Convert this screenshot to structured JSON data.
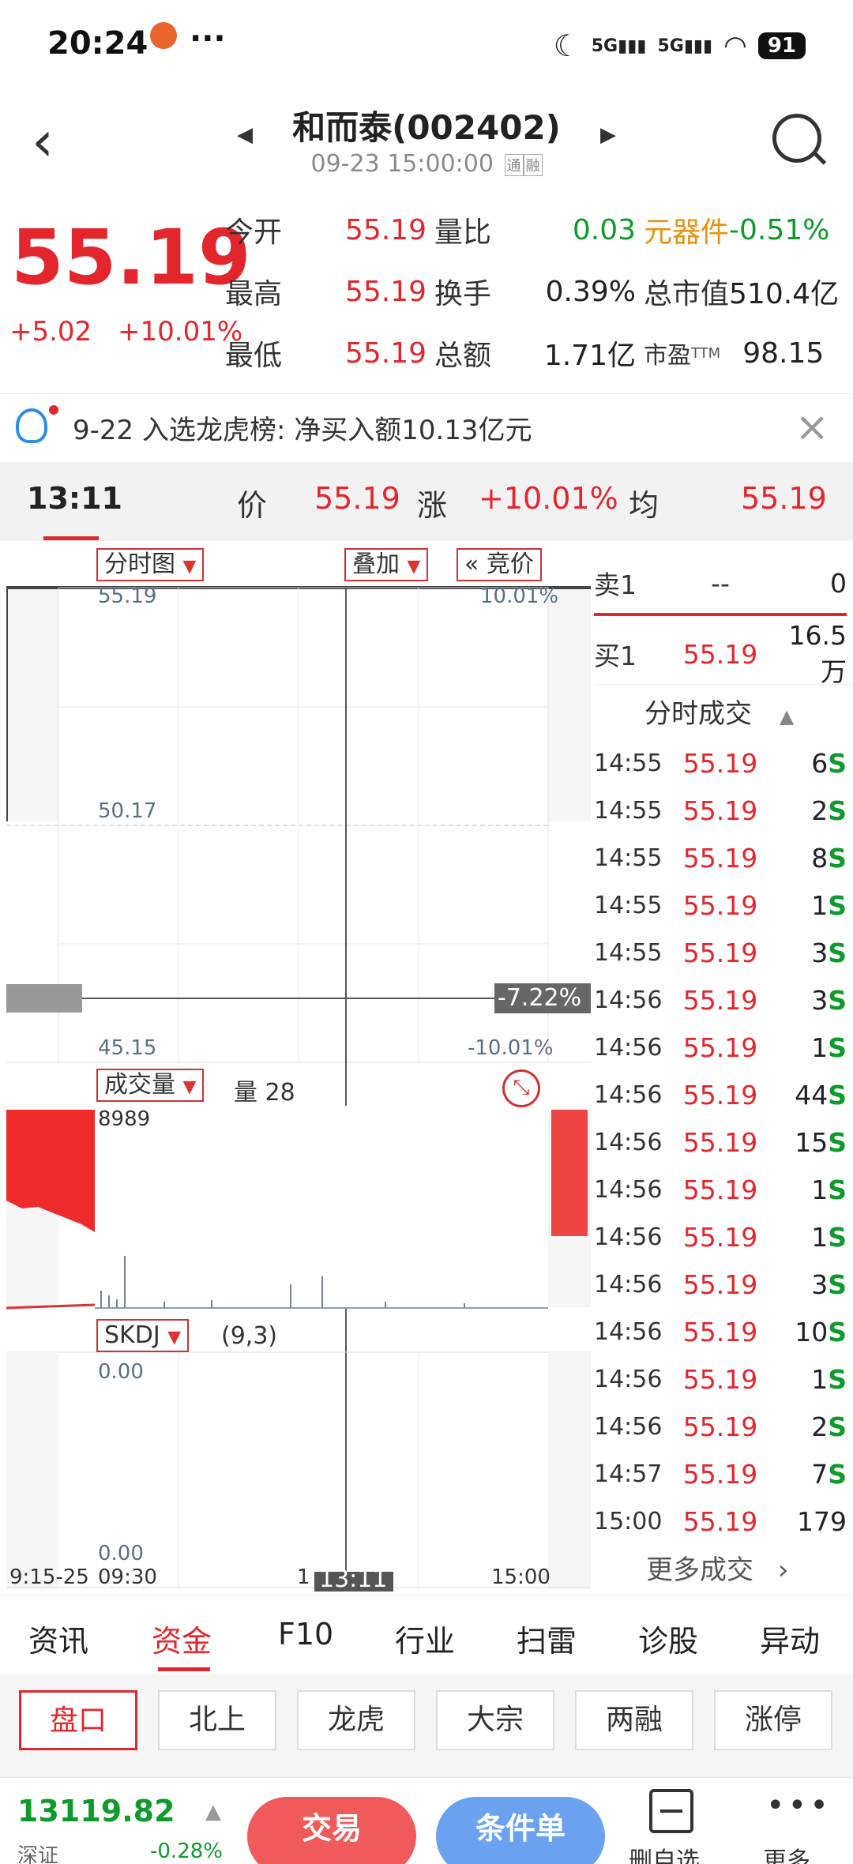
{
  "status_bar": {
    "time": "20:24",
    "dots": "···",
    "signal1": "5G",
    "signal2": "5G",
    "battery": "91"
  },
  "header": {
    "title": "和而泰(002402)",
    "subtitle": "09-23 15:00:00",
    "badge1": "通",
    "badge2": "融"
  },
  "quote": {
    "price": "55.19",
    "change": "+5.02",
    "change_pct": "+10.01%",
    "rows": [
      {
        "l1": "今开",
        "v1": "55.19",
        "l2": "量比",
        "v2": "0.03",
        "l3": "元器件",
        "v3": "-0.51%"
      },
      {
        "l1": "最高",
        "v1": "55.19",
        "l2": "换手",
        "v2": "0.39%",
        "l3": "总市值",
        "v3": "510.4亿"
      },
      {
        "l1": "最低",
        "v1": "55.19",
        "l2": "总额",
        "v2": "1.71亿",
        "l3": "市盈",
        "v3": "98.15",
        "l3_sup": "TTM"
      }
    ]
  },
  "notice": {
    "text": "9-22 入选龙虎榜: 净买入额10.13亿元"
  },
  "info_bar": {
    "time": "13:11",
    "price_label": "价",
    "price": "55.19",
    "chg_label": "涨",
    "chg": "+10.01%",
    "avg_label": "均",
    "avg": "55.19"
  },
  "chart": {
    "tag_main": "分时图",
    "tag_overlay": "叠加",
    "tag_auction": "竞价",
    "auction_prefix": "«",
    "y_top": "55.19",
    "y_top_pct": "10.01%",
    "y_mid": "50.17",
    "y_bot": "45.15",
    "y_bot_pct": "-10.01%",
    "cross_pct": "-7.22%",
    "vol_tag": "成交量",
    "vol_label": "量 28",
    "vol_max": "8989",
    "ind_tag": "SKDJ",
    "ind_params": "(9,3)",
    "ind_top": "0.00",
    "ind_bot": "0.00",
    "x_labels": [
      "9:15-25",
      "09:30",
      "1",
      "13:11",
      "15:00"
    ],
    "accent": "#e3262d"
  },
  "order_book": {
    "sell_label": "卖1",
    "sell_price": "--",
    "sell_vol": "0",
    "buy_label": "买1",
    "buy_price": "55.19",
    "buy_vol": "16.5万"
  },
  "ticks": {
    "header": "分时成交",
    "rows": [
      {
        "t": "14:55",
        "p": "55.19",
        "v": "6",
        "s": "S"
      },
      {
        "t": "14:55",
        "p": "55.19",
        "v": "2",
        "s": "S"
      },
      {
        "t": "14:55",
        "p": "55.19",
        "v": "8",
        "s": "S"
      },
      {
        "t": "14:55",
        "p": "55.19",
        "v": "1",
        "s": "S"
      },
      {
        "t": "14:55",
        "p": "55.19",
        "v": "3",
        "s": "S"
      },
      {
        "t": "14:56",
        "p": "55.19",
        "v": "3",
        "s": "S"
      },
      {
        "t": "14:56",
        "p": "55.19",
        "v": "1",
        "s": "S"
      },
      {
        "t": "14:56",
        "p": "55.19",
        "v": "44",
        "s": "S"
      },
      {
        "t": "14:56",
        "p": "55.19",
        "v": "15",
        "s": "S"
      },
      {
        "t": "14:56",
        "p": "55.19",
        "v": "1",
        "s": "S"
      },
      {
        "t": "14:56",
        "p": "55.19",
        "v": "1",
        "s": "S"
      },
      {
        "t": "14:56",
        "p": "55.19",
        "v": "3",
        "s": "S"
      },
      {
        "t": "14:56",
        "p": "55.19",
        "v": "10",
        "s": "S"
      },
      {
        "t": "14:56",
        "p": "55.19",
        "v": "1",
        "s": "S"
      },
      {
        "t": "14:56",
        "p": "55.19",
        "v": "2",
        "s": "S"
      },
      {
        "t": "14:57",
        "p": "55.19",
        "v": "7",
        "s": "S"
      },
      {
        "t": "15:00",
        "p": "55.19",
        "v": "179",
        "s": ""
      }
    ],
    "more": "更多成交"
  },
  "tabs": [
    "资讯",
    "资金",
    "F10",
    "行业",
    "扫雷",
    "诊股",
    "异动"
  ],
  "subtabs": [
    "盘口",
    "北上",
    "龙虎",
    "大宗",
    "两融",
    "涨停"
  ],
  "bottom_bar": {
    "index_value": "13119.82",
    "index_name": "深证",
    "index_chg": "-0.28%",
    "trade": "交易",
    "condition": "条件单",
    "remove": "删自选",
    "more": "更多"
  }
}
